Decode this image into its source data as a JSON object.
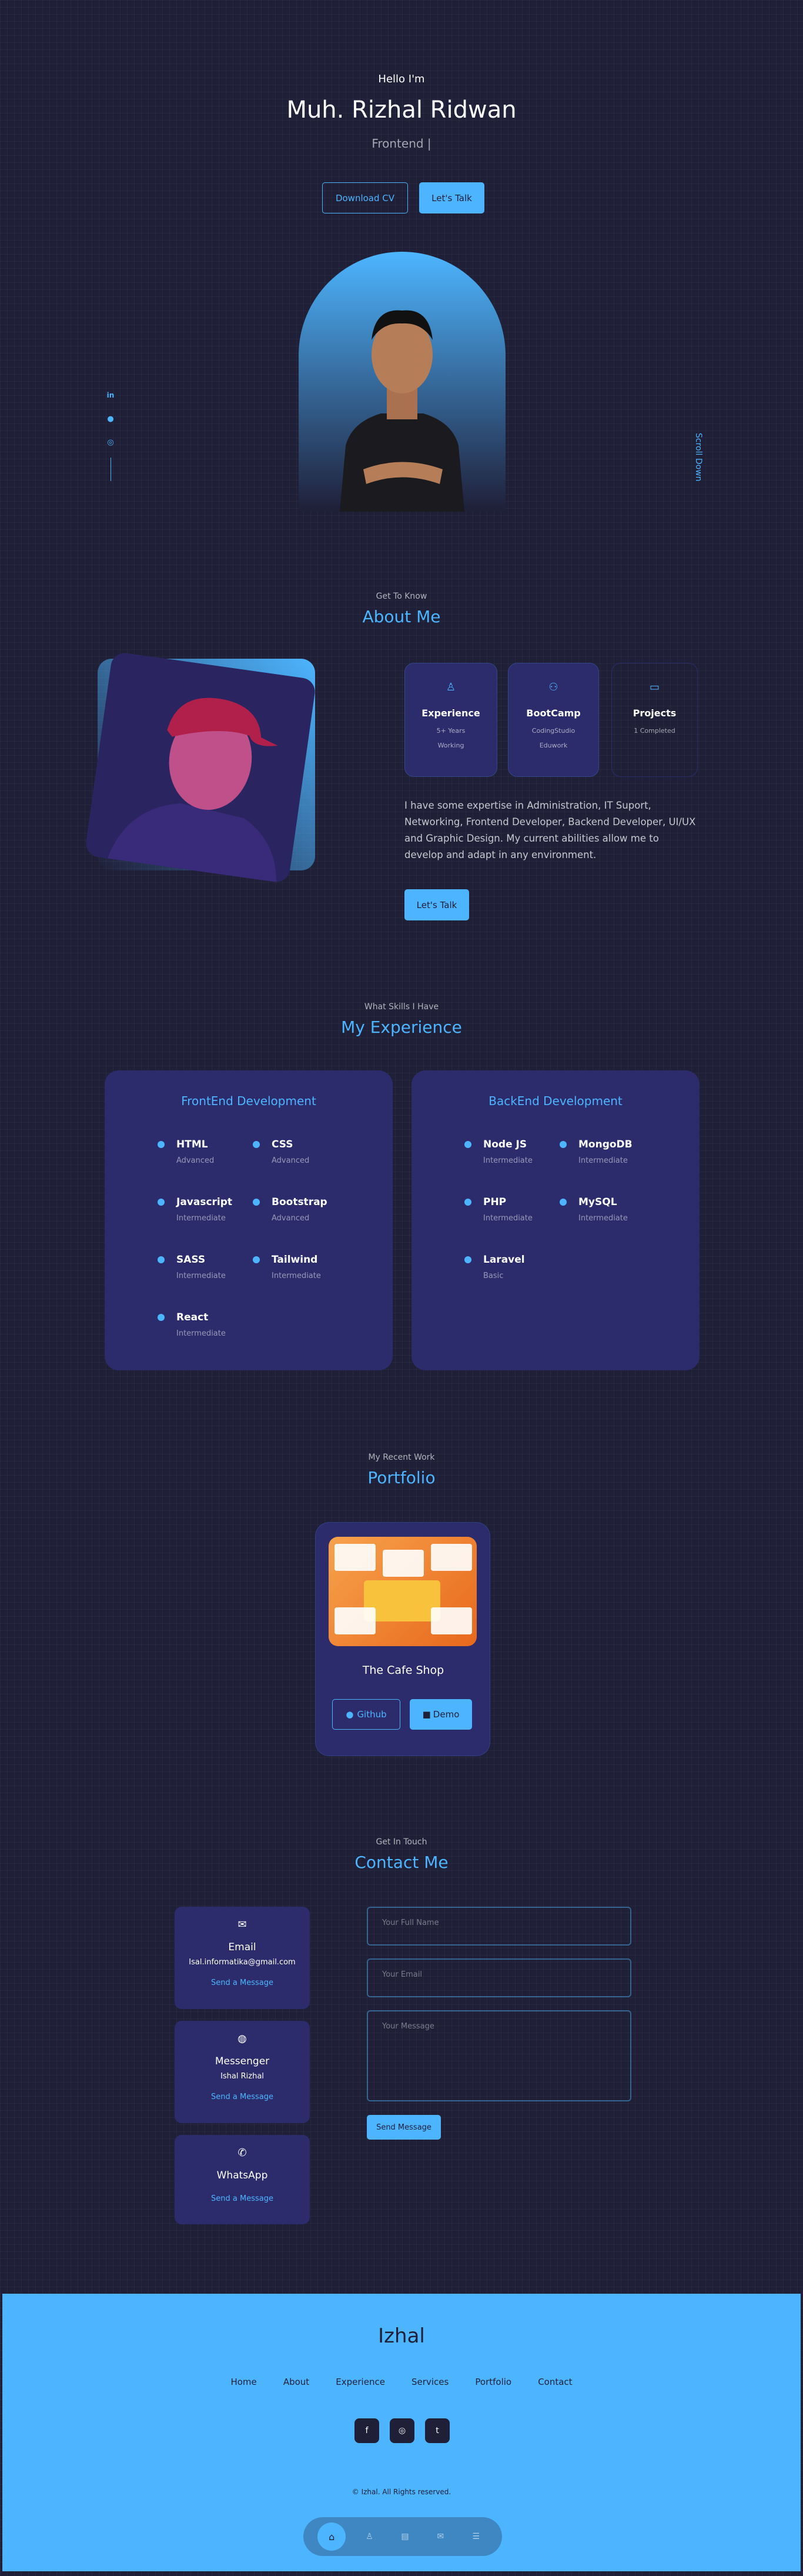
{
  "hero": {
    "greeting": "Hello I'm",
    "name": "Muh. Rizhal Ridwan",
    "role": "Frontend |",
    "download_cv": "Download CV",
    "lets_talk": "Let's Talk",
    "scroll_down": "Scroll Down"
  },
  "socials_side": [
    "linkedin-icon",
    "github-icon",
    "dribbble-icon"
  ],
  "about": {
    "sub": "Get To Know",
    "title": "About Me",
    "cards": [
      {
        "title": "Experience",
        "line1": "5+ Years",
        "line2": "Working",
        "icon": "award-icon"
      },
      {
        "title": "BootCamp",
        "line1": "CodingStudio",
        "line2": "Eduwork",
        "icon": "users-icon"
      },
      {
        "title": "Projects",
        "line1": "1 Completed",
        "line2": "",
        "icon": "folder-icon"
      }
    ],
    "text": "I have some expertise in Administration, IT Suport, Networking, Frontend Developer, Backend Developer, UI/UX and Graphic Design. My current abilities allow me to develop and adapt in any environment.",
    "button": "Let's Talk"
  },
  "experience": {
    "sub": "What Skills I Have",
    "title": "My Experience",
    "frontend": {
      "title": "FrontEnd Development",
      "skills": [
        {
          "name": "HTML",
          "level": "Advanced"
        },
        {
          "name": "CSS",
          "level": "Advanced"
        },
        {
          "name": "Javascript",
          "level": "Intermediate"
        },
        {
          "name": "Bootstrap",
          "level": "Advanced"
        },
        {
          "name": "SASS",
          "level": "Intermediate"
        },
        {
          "name": "Tailwind",
          "level": "Intermediate"
        },
        {
          "name": "React",
          "level": "Intermediate"
        }
      ]
    },
    "backend": {
      "title": "BackEnd Development",
      "skills": [
        {
          "name": "Node JS",
          "level": "Intermediate"
        },
        {
          "name": "MongoDB",
          "level": "Intermediate"
        },
        {
          "name": "PHP",
          "level": "Intermediate"
        },
        {
          "name": "MySQL",
          "level": "Intermediate"
        },
        {
          "name": "Laravel",
          "level": "Basic"
        }
      ]
    }
  },
  "portfolio": {
    "sub": "My Recent Work",
    "title": "Portfolio",
    "item": {
      "title": "The Cafe Shop",
      "github": "Github",
      "demo": "Demo"
    }
  },
  "contact": {
    "sub": "Get In Touch",
    "title": "Contact Me",
    "options": [
      {
        "title": "Email",
        "value": "Isal.informatika@gmail.com",
        "link": "Send a Message",
        "icon": "mail-icon"
      },
      {
        "title": "Messenger",
        "value": "Ishal Rizhal",
        "link": "Send a Message",
        "icon": "messenger-icon"
      },
      {
        "title": "WhatsApp",
        "value": "",
        "link": "Send a Message",
        "icon": "whatsapp-icon"
      }
    ],
    "name_placeholder": "Your Full Name",
    "email_placeholder": "Your Email",
    "message_placeholder": "Your Message",
    "send": "Send Message"
  },
  "footer": {
    "logo": "Izhal",
    "nav": [
      "Home",
      "About",
      "Experience",
      "Services",
      "Portfolio",
      "Contact"
    ],
    "socials": [
      "facebook-icon",
      "instagram-icon",
      "twitter-icon"
    ],
    "copyright": "© Izhal. All Rights reserved."
  },
  "bottom_nav": [
    "home-icon",
    "user-icon",
    "book-icon",
    "message-icon",
    "list-icon"
  ],
  "colors": {
    "bg": "#1f1f38",
    "primary": "#4db5ff",
    "card": "#2c2c6c"
  }
}
